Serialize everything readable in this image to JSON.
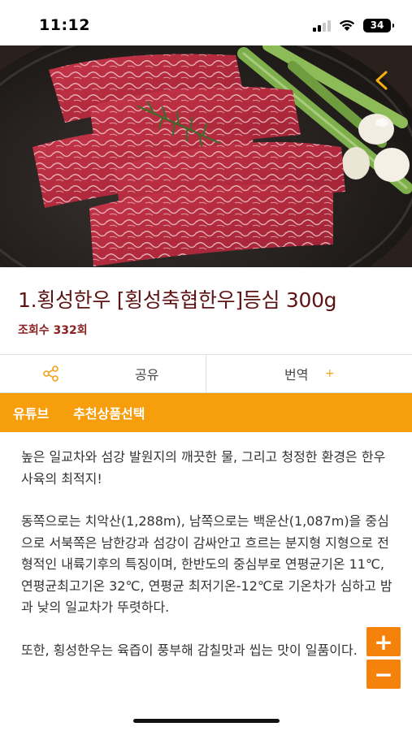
{
  "status_bar": {
    "time": "11:12",
    "battery": "34"
  },
  "hero": {
    "image": "grilled-beef-striploin-photo",
    "back_icon": "chevron-left-icon"
  },
  "product": {
    "title": "1.횡성한우 [횡성축협한우]등심 300g",
    "view_count": "조회수 332회"
  },
  "actions": {
    "share_icon": "share-icon",
    "share_label": "공유",
    "translate_label": "번역",
    "translate_plus": "+"
  },
  "tabs": [
    {
      "label": "유튜브"
    },
    {
      "label": "추천상품선택"
    }
  ],
  "content": {
    "paragraphs": [
      "높은 일교차와 섬강 발원지의 깨끗한 물, 그리고 청정한 환경은 한우 사육의 최적지!",
      "동쪽으로는 치악산(1,288m), 남쪽으로는 백운산(1,087m)을 중심으로 서북쪽은 남한강과 섬강이 감싸안고 흐르는 분지형 지형으로 전형적인 내륙기후의 특징이며, 한반도의 중심부로 연평균기온 11℃, 연평균최고기온 32℃, 연평균 최저기온-12℃로 기온차가 심하고 밤과 낮의 일교차가 뚜렷하다.",
      "또한, 횡성한우는 육즙이 풍부해 감칠맛과 씹는 맛이 일품이다."
    ]
  },
  "zoom": {
    "plus": "+",
    "minus": "−"
  },
  "colors": {
    "accent_orange": "#f79e0c",
    "button_orange": "#f4820b",
    "title_red": "#5e1414"
  }
}
